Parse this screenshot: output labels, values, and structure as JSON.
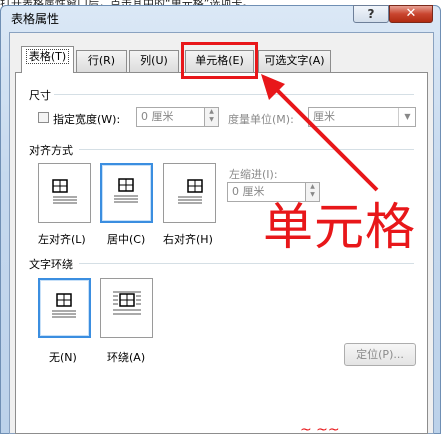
{
  "page_header_fragment": "打开表格属性窗口后，点击其中的“单元格”选项卡。",
  "window": {
    "title": "表格属性",
    "help_label": "?",
    "close_label": "✕"
  },
  "tabs": [
    {
      "label": "表格(T)"
    },
    {
      "label": "行(R)"
    },
    {
      "label": "列(U)"
    },
    {
      "label": "单元格(E)"
    },
    {
      "label": "可选文字(A)"
    }
  ],
  "size_section": {
    "title": "尺寸",
    "preferred_width_label": "指定宽度(W):",
    "preferred_width_value": "0 厘米",
    "measure_in_label": "度量单位(M):",
    "measure_in_value": "厘米"
  },
  "alignment_section": {
    "title": "对齐方式",
    "options": [
      {
        "label": "左对齐(L)"
      },
      {
        "label": "居中(C)"
      },
      {
        "label": "右对齐(H)"
      }
    ],
    "indent_label": "左缩进(I):",
    "indent_value": "0 厘米"
  },
  "wrap_section": {
    "title": "文字环绕",
    "options": [
      {
        "label": "无(N)"
      },
      {
        "label": "环绕(A)"
      }
    ],
    "positioning_label": "定位(P)..."
  },
  "annotation": {
    "text": "单元格",
    "bottom_fragment": "~ ~~"
  },
  "colors": {
    "annotation_red": "#e8171a",
    "selection_blue": "#3b8ee0"
  }
}
